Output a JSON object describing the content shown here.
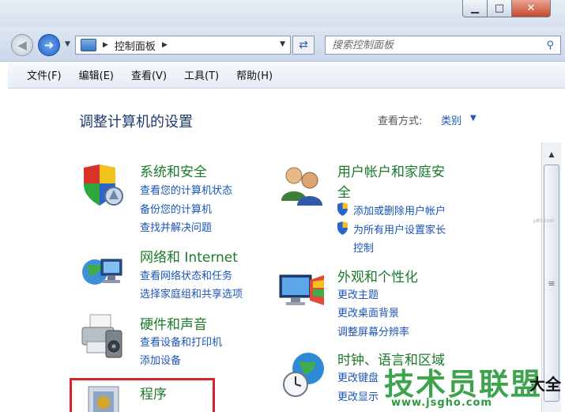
{
  "window": {
    "controls": {
      "minimize": "▁",
      "maximize": "□",
      "close": "✕"
    }
  },
  "nav": {
    "address_segments": [
      "控制面板"
    ],
    "search_placeholder": "搜索控制面板"
  },
  "menu": [
    "文件(F)",
    "编辑(E)",
    "查看(V)",
    "工具(T)",
    "帮助(H)"
  ],
  "page": {
    "title": "调整计算机的设置",
    "view_by_label": "查看方式:",
    "view_by_value": "类别"
  },
  "categories": [
    {
      "title": "系统和安全",
      "icon": "shield-icon",
      "links": [
        "查看您的计算机状态",
        "备份您的计算机",
        "查找并解决问题"
      ]
    },
    {
      "title": "网络和 Internet",
      "icon": "network-icon",
      "links": [
        "查看网络状态和任务",
        "选择家庭组和共享选项"
      ]
    },
    {
      "title": "硬件和声音",
      "icon": "printer-icon",
      "links": [
        "查看设备和打印机",
        "添加设备"
      ]
    },
    {
      "title": "程序",
      "icon": "programs-icon",
      "links": []
    },
    {
      "title_line1": "用户帐户和家庭安",
      "title_line2": "全",
      "icon": "users-icon",
      "links": [
        "添加或删除用户帐户",
        "为所有用户设置家长",
        "控制"
      ]
    },
    {
      "title": "外观和个性化",
      "icon": "appearance-icon",
      "links": [
        "更改主题",
        "更改桌面背景",
        "调整屏幕分辨率"
      ]
    },
    {
      "title": "时钟、语言和区域",
      "icon": "clock-globe-icon",
      "links": [
        "更改键盘",
        "更改显示"
      ]
    }
  ],
  "watermark": {
    "brand": "技术员联盟",
    "suffix": "大全",
    "url": "www.jsgho.com",
    "small": "p85.com"
  },
  "colors": {
    "category_title": "#1b7a2a",
    "link": "#1c55b5",
    "page_title": "#1e3a6e",
    "highlight": "#d2242a"
  }
}
